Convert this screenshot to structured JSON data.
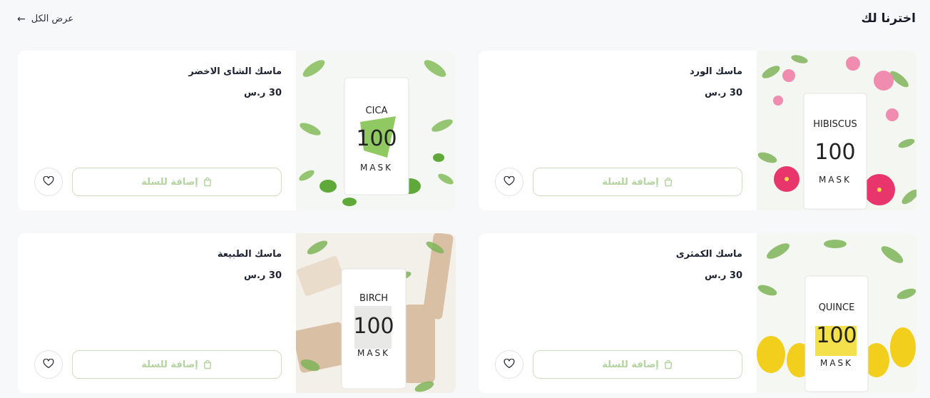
{
  "header": {
    "title": "اخترنا لك",
    "view_all": "عرض الكل"
  },
  "products": [
    {
      "name": "ماسك الورد",
      "price": "30 ر.س",
      "add_label": "إضافة للسلة",
      "pack": {
        "variant": "HIBISCUS",
        "number": "100",
        "word": "MASK"
      }
    },
    {
      "name": "ماسك الشاى الاخضر",
      "price": "30 ر.س",
      "add_label": "إضافة للسلة",
      "pack": {
        "variant": "CICA",
        "number": "100",
        "word": "MASK"
      }
    },
    {
      "name": "ماسك الكمثرى",
      "price": "30 ر.س",
      "add_label": "إضافة للسلة",
      "pack": {
        "variant": "QUINCE",
        "number": "100",
        "word": "MASK"
      }
    },
    {
      "name": "ماسك الطبيعة",
      "price": "30 ر.س",
      "add_label": "إضافة للسلة",
      "pack": {
        "variant": "BIRCH",
        "number": "100",
        "word": "MASK"
      }
    }
  ],
  "colors": {
    "accent_green": "#b3d3a0",
    "button_border": "#cfe0c0",
    "page_bg": "#f7f8fa",
    "text_dark": "#1d2230"
  },
  "icons": {
    "back_arrow": "arrow-left-icon",
    "cart": "shopping-bag-icon",
    "favorite": "heart-icon"
  }
}
